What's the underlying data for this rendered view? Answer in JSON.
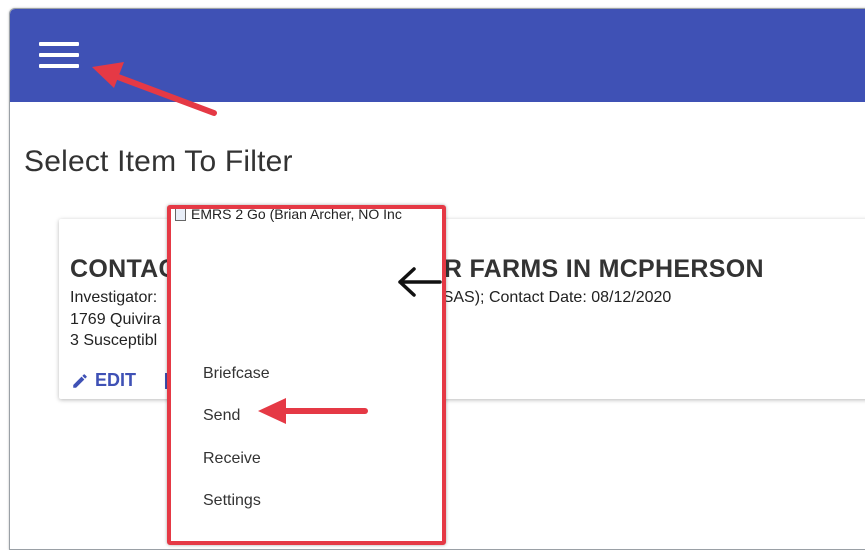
{
  "page": {
    "title": "Select Item To Filter"
  },
  "icons": {
    "menu": "hamburger-menu-icon",
    "edit": "pencil-icon",
    "back": "arrow-left-icon"
  },
  "card": {
    "title_left": "CONTAC",
    "title_right": "R FARMS IN MCPHERSON",
    "line1_left": "Investigator:",
    "line1_right": "NSAS); Contact Date: 08/12/2020",
    "line2": "1769 Quivira",
    "line3": "3 Susceptibl",
    "edit_label": "EDIT"
  },
  "popup": {
    "window_title": "EMRS 2 Go (Brian Archer, NO Inc",
    "menu_items": [
      "Briefcase",
      "Send",
      "Receive",
      "Settings"
    ]
  },
  "colors": {
    "appbar": "#3f51b5",
    "accent": "#3f51b5",
    "annotation": "#e53945"
  }
}
